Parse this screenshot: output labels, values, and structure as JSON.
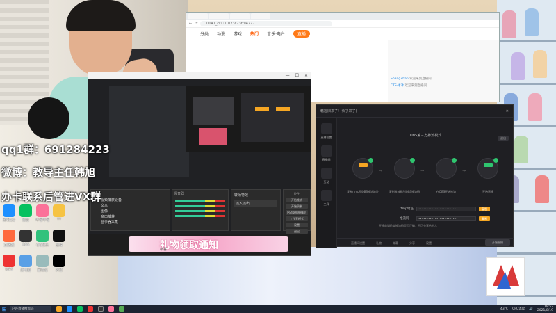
{
  "overlay": {
    "qq_group": "qq1群：691284223",
    "weibo": "微博：教导主任韩旭",
    "business": "办卡联系后管进VX群"
  },
  "browser": {
    "url": "...0041_cr11i1023c23rfu4777",
    "nav_items": [
      "分类",
      "动漫",
      "游戏",
      "热门",
      "音乐·电台"
    ],
    "nav_selected": "热门",
    "nav_pill": "直播",
    "chat": [
      {
        "user": "ShangZhan",
        "text": "欢迎来到直播间"
      },
      {
        "user": "CTS·冰冰",
        "text": "欢迎来到直播间"
      }
    ]
  },
  "obs": {
    "sources_header": "来源",
    "sources": [
      "视频捕获设备",
      "文本",
      "图像",
      "窗口捕获",
      "显示器采集"
    ],
    "mixer_header": "混音器",
    "transitions_header": "转场特效",
    "transition_value": "淡入淡出",
    "controls_header": "控件",
    "controls": [
      "开始推流",
      "开始录制",
      "启动虚拟摄像机",
      "工作室模式",
      "设置",
      "退出"
    ]
  },
  "gift_banner": {
    "title": "礼物领取通知",
    "sub": "恭喜"
  },
  "tool": {
    "title": "韩旭旧来了! (长了来了)",
    "heading": "OBS第三方推流模式",
    "exit_label": "退出",
    "steps": [
      {
        "label": "复制rtmp到OBS推流地址"
      },
      {
        "label": "复制推流码到OBS推流码"
      },
      {
        "label": "在OBS开始推流"
      },
      {
        "label": "开始直播"
      }
    ],
    "fields": [
      {
        "label": "rtmp地址",
        "value": "••••••••••••••••••••••••",
        "button": "复制"
      },
      {
        "label": "推流码",
        "value": "••••••••••••••••••••••••",
        "button": "复制"
      }
    ],
    "tip": "开播前请检查推流码是否正确，不可分享给他人",
    "sidebar": [
      "直播设置",
      "直播间",
      "互动",
      "工具"
    ],
    "bottom_items": [
      "直播间设置",
      "礼物",
      "弹幕",
      "分享",
      "设置"
    ],
    "start_live": "开始直播"
  },
  "taskbar": {
    "search": "户外直播推流码",
    "tray_temp": "43°C",
    "tray_cpu": "CPU温度",
    "time": "19:52",
    "date": "2021/8/19"
  },
  "desktop_icons": [
    "腾讯QQ",
    "微信",
    "哔哩哔哩",
    "YY",
    "直播姬",
    "OBS",
    "QQ音乐",
    "剪映",
    "WPS",
    "此电脑",
    "回收站",
    "抖音"
  ],
  "colors": {
    "accent_orange": "#f5a623",
    "success_green": "#2fc56f",
    "tool_bg": "#1f1f23",
    "gift_pink": "#f6a7c9"
  }
}
